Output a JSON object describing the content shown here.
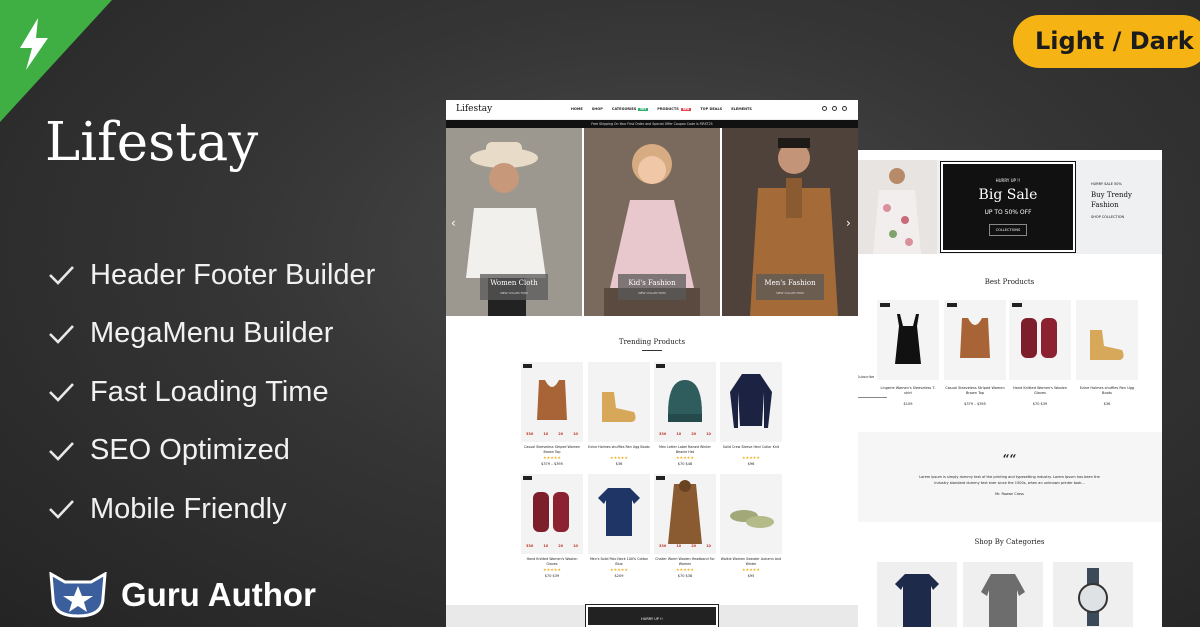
{
  "badge": {
    "label": "Light / Dark"
  },
  "brand": {
    "name": "Lifestay"
  },
  "features": [
    "Header Footer Builder",
    "MegaMenu Builder",
    "Fast Loading Time",
    "SEO Optimized",
    "Mobile Friendly"
  ],
  "author": {
    "name": "Guru Author"
  },
  "colors": {
    "accent_green": "#3fae43",
    "badge_yellow": "#f6b314",
    "background": "#353535"
  },
  "front": {
    "logo": "Lifestay",
    "menu": [
      "HOME",
      "SHOP",
      "CATEGORIES",
      "PRODUCTS",
      "TOP DEALS",
      "ELEMENTS"
    ],
    "menu_tags": {
      "hot": "HOT",
      "new": "NEW"
    },
    "promo": "Free Shipping On Your First Order and Special Offer Coupon Code is FIRST25",
    "hero": [
      {
        "title": "Women Cloth",
        "sub": "NEW COLLECTION"
      },
      {
        "title": "Kid's Fashion",
        "sub": "NEW COLLECTION"
      },
      {
        "title": "Men's Fashion",
        "sub": "NEW COLLECTION"
      }
    ],
    "trending_title": "Trending Products",
    "products": [
      {
        "name": "Casual Sleeveless Striped Women Brown Top",
        "price": "$379 – $395"
      },
      {
        "name": "Ezine Holmes shuffles Ren Ugg Boots",
        "price": "$36"
      },
      {
        "name": "Men Letter Label Raised Winter Beanie Hat",
        "price": "$70  $48"
      },
      {
        "name": "Solid Crew Sleeve Henl Collar Knit",
        "price": "$96"
      },
      {
        "name": "Hand Knitted Women's Woolen Gloves",
        "price": "$70  $39"
      },
      {
        "name": "Men's Solid Polo Neck 100% Cotton Blue",
        "price": "$209"
      },
      {
        "name": "Chalier Worm Woolen Headband For Women",
        "price": "$70  $38"
      },
      {
        "name": "Walkie Women Sweater Autumn And Winter",
        "price": "$95"
      }
    ],
    "timer": [
      "330",
      "10",
      "20",
      "10"
    ],
    "sale_strip": "HURRY UP !!"
  },
  "back": {
    "sale": {
      "top": "HURRY UP !!",
      "title": "Big Sale",
      "offer": "UP TO 50% OFF",
      "button": "COLLECTIONS"
    },
    "trend": {
      "top": "HURRY SALE 50%",
      "title": "Buy Trendy Fashion",
      "link": "SHOP COLLECTION"
    },
    "best_title": "Best Products",
    "best": [
      {
        "name": "Lingerie Women's Sleeveless T-shirt",
        "price": "$109"
      },
      {
        "name": "Casual Sleeveless Striped Women Brown Top",
        "price": "$379 – $395"
      },
      {
        "name": "Hand Knitted Women's Woolen Gloves",
        "price": "$70  $39"
      },
      {
        "name": "Ezine Holmes shuffles Ren Ugg Boots",
        "price": "$36"
      }
    ],
    "newsletter": "Subscribe",
    "testimonial": {
      "text": "Lorem ipsum is simply dummy text of the printing and typesetting industry. Lorem Ipsum has been the industry standard dummy text ever since the 1500s, when an unknown printer took...",
      "author": "Mr. Rowan Cross"
    },
    "categories_title": "Shop By Categories"
  }
}
